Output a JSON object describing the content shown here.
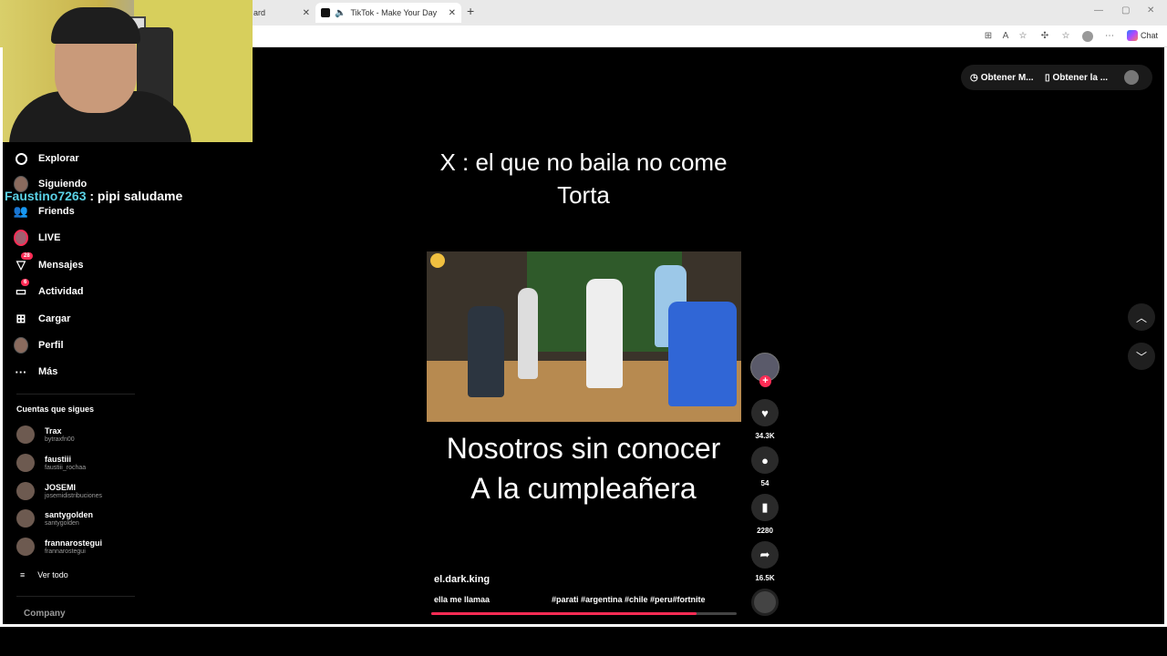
{
  "browser": {
    "prev_tab_label": "ard",
    "active_tab_label": "TikTok - Make Your Day",
    "chat_label": "Chat"
  },
  "chat_overlay": {
    "username": "Faustino7263",
    "message": ": pipi saludame"
  },
  "sidebar": {
    "items": [
      {
        "label": "Explorar",
        "icon": "compass-icon"
      },
      {
        "label": "Siguiendo",
        "icon": "avatar-icon"
      },
      {
        "label": "Friends",
        "icon": "friends-icon"
      },
      {
        "label": "LIVE",
        "icon": "live-avatar-icon"
      },
      {
        "label": "Mensajes",
        "icon": "messages-icon",
        "badge": "28"
      },
      {
        "label": "Actividad",
        "icon": "activity-icon",
        "badge": "6"
      },
      {
        "label": "Cargar",
        "icon": "upload-icon"
      },
      {
        "label": "Perfil",
        "icon": "profile-icon"
      },
      {
        "label": "Más",
        "icon": "more-icon"
      }
    ],
    "following_title": "Cuentas que sigues",
    "following": [
      {
        "name": "Trax",
        "handle": "bytraxfn00"
      },
      {
        "name": "faustiii",
        "handle": "faustiii_rochaa"
      },
      {
        "name": "JOSEMI",
        "handle": "josemidistribuciones"
      },
      {
        "name": "santygolden",
        "handle": "santygolden"
      },
      {
        "name": "frannarostegui",
        "handle": "frannarostegui"
      }
    ],
    "see_all": "Ver todo",
    "company": "Company"
  },
  "top_controls": {
    "get_app_1": "Obtener M...",
    "get_app_2": "Obtener la ..."
  },
  "video": {
    "title_line1": "X : el que no baila no come",
    "title_line2": "Torta",
    "caption_line1": "Nosotros sin conocer",
    "caption_line2": "A la cumpleañera",
    "author": "el.dark.king",
    "description": "ella me llamaa",
    "hashtags": "#parati #argentina #chile #peru#fortnite",
    "progress_fraction": 0.87
  },
  "actions": {
    "likes": "34.3K",
    "comments": "54",
    "saves": "2280",
    "shares": "16.5K"
  },
  "colors": {
    "accent": "#fe2c55",
    "chat_username": "#5ad1e6",
    "background": "#000000"
  }
}
